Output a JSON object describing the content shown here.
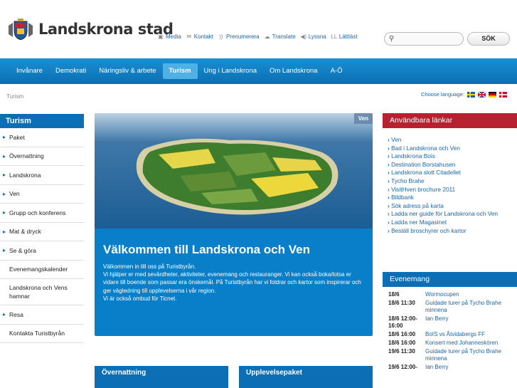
{
  "header": {
    "logo_text": "Landskrona stad",
    "tools": [
      {
        "icon": "media-icon",
        "label": "Media"
      },
      {
        "icon": "contact-icon",
        "label": "Kontakt"
      },
      {
        "icon": "rss-icon",
        "label": "Prenumerera"
      },
      {
        "icon": "translate-icon",
        "label": "Translate"
      },
      {
        "icon": "speaker-icon",
        "label": "Lyssna"
      },
      {
        "icon": "easyread-icon",
        "label": "Lättläst"
      }
    ],
    "search_placeholder": "",
    "search_button": "SÖK"
  },
  "nav": {
    "items": [
      "Invånare",
      "Demokrati",
      "Näringsliv & arbete",
      "Turism",
      "Ung i Landskrona",
      "Om Landskrona",
      "A-Ö"
    ],
    "active": "Turism"
  },
  "breadcrumb": "Turism",
  "language": {
    "label": "Choose language:",
    "flags": [
      "sv",
      "en",
      "de",
      "dk"
    ]
  },
  "sidebar": {
    "title": "Turism",
    "items": [
      {
        "label": "Paket",
        "arrow": true
      },
      {
        "label": "Övernattning",
        "arrow": true
      },
      {
        "label": "Landskrona",
        "arrow": true
      },
      {
        "label": "Ven",
        "arrow": true
      },
      {
        "label": "Grupp och konferens",
        "arrow": true
      },
      {
        "label": "Mat & dryck",
        "arrow": true
      },
      {
        "label": "Se & göra",
        "arrow": true
      },
      {
        "label": "Evenemangskalender",
        "arrow": false
      },
      {
        "label": "Landskrona och Vens hamnar",
        "arrow": false
      },
      {
        "label": "Resa",
        "arrow": true
      },
      {
        "label": "Kontakta Turistbyrån",
        "arrow": false
      }
    ]
  },
  "hero": {
    "tag": "Ven",
    "title": "Välkommen till Landskrona och Ven",
    "text": "Välkommen in till oss på Turistbyrån.\nVi hjälper er med sevärdheter, aktiviteter, evenemang och restauranger. Vi kan också boka/lotsa er vidare till boende som passar era önskemål. På Turistbyrån har vi foldrar och kartor som inspirerar och ger vägledning till upplevelserna i vår region.\nVi är också ombud för Ticnet."
  },
  "cards": [
    "Övernattning",
    "Upplevelsepaket"
  ],
  "useful_links": {
    "title": "Användbara länkar",
    "items": [
      "Ven",
      "Bad i Landskrona och Ven",
      "Landskrona Bois",
      "Destination Borstahusen",
      "Landskrona slott Citadellet",
      "Tycho Brahe",
      "VisitHven brochure 2011",
      "Bildbank",
      "Sök adress på karta",
      "Ladda ner guide för Landskrona och Ven",
      "Ladda ner Magasinet",
      "Beställ broschyrer och kartor"
    ]
  },
  "events": {
    "title": "Evenemang",
    "items": [
      {
        "date": "18/6",
        "title": "Wormocupen"
      },
      {
        "date": "18/6 11:30",
        "title": "Guidade turer på Tycho Brahe minnena"
      },
      {
        "date": "18/6 12:00-16:00",
        "title": "Ian Berry"
      },
      {
        "date": "18/6 16:00",
        "title": "BoIS vs Åtvidabergs FF"
      },
      {
        "date": "18/6 16:00",
        "title": "Konsert med Johanneskören"
      },
      {
        "date": "19/6 11:30",
        "title": "Guidade turer på Tycho Brahe minnena"
      },
      {
        "date": "19/6 12:00-",
        "title": "Ian Berry"
      }
    ]
  }
}
